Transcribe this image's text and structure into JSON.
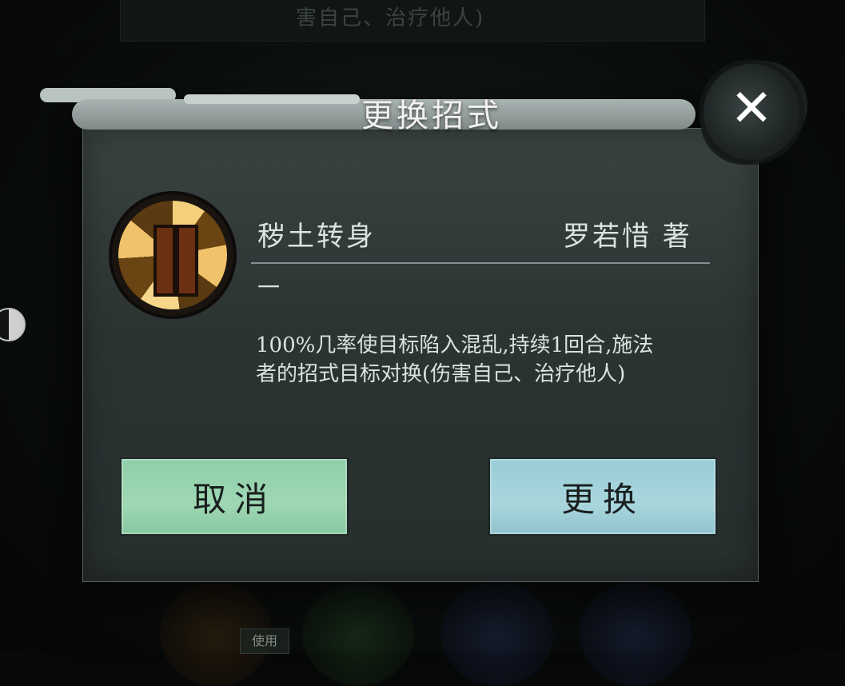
{
  "background": {
    "hint_text": "害自己、治疗他人)",
    "use_tag": "使用"
  },
  "dialog": {
    "title": "更换招式",
    "close_glyph": "✕",
    "skill": {
      "name": "秽土转身",
      "author": "罗若惜 著",
      "level": "一",
      "description": "100%几率使目标陷入混乱,持续1回合,施法者的招式目标对换(伤害自己、治疗他人)",
      "icon": "pillar-skill-icon"
    },
    "buttons": {
      "cancel": "取消",
      "confirm": "更换"
    }
  },
  "colors": {
    "cancel_button": "#9fd7b3",
    "confirm_button": "#a9d6dd",
    "dialog_bg": "#2c3433",
    "text": "#d9e3e1"
  }
}
